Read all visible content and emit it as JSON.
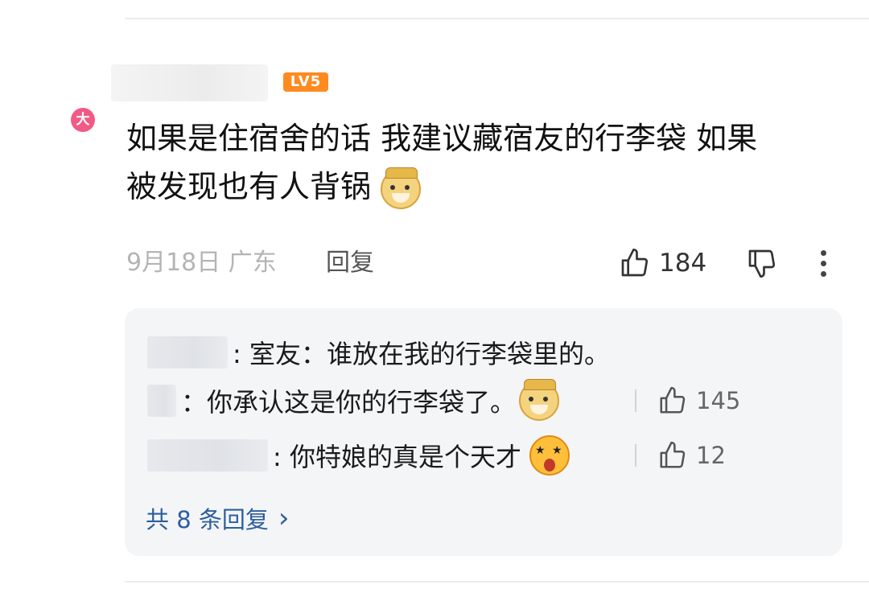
{
  "comment": {
    "level_badge": "LV5",
    "region_tag": "大",
    "text_line1": "如果是住宿舍的话 我建议藏宿友的行李袋  如果",
    "text_line2": "被发现也有人背锅",
    "date_location": "9月18日 广东",
    "reply_label": "回复",
    "likes": "184"
  },
  "replies": {
    "items": [
      {
        "text": ": 室友：谁放在我的行李袋里的。",
        "likes": null
      },
      {
        "text": "：你承认这是你的行李袋了。",
        "likes": "145"
      },
      {
        "text": ": 你特娘的真是个天才",
        "likes": "12"
      }
    ],
    "total_label": "共 8 条回复",
    "chevron": "›"
  },
  "icons": {
    "like": "thumbs-up-icon",
    "dislike": "thumbs-down-icon",
    "more": "more-vertical-icon",
    "emoji_doge": "doge-emoji-icon",
    "emoji_shock": "starstruck-emoji-icon"
  },
  "colors": {
    "level_badge": "#ff8a1f",
    "region_tag": "#f25a86",
    "link": "#2c5e9e",
    "meta_text": "#b4b4b4"
  }
}
